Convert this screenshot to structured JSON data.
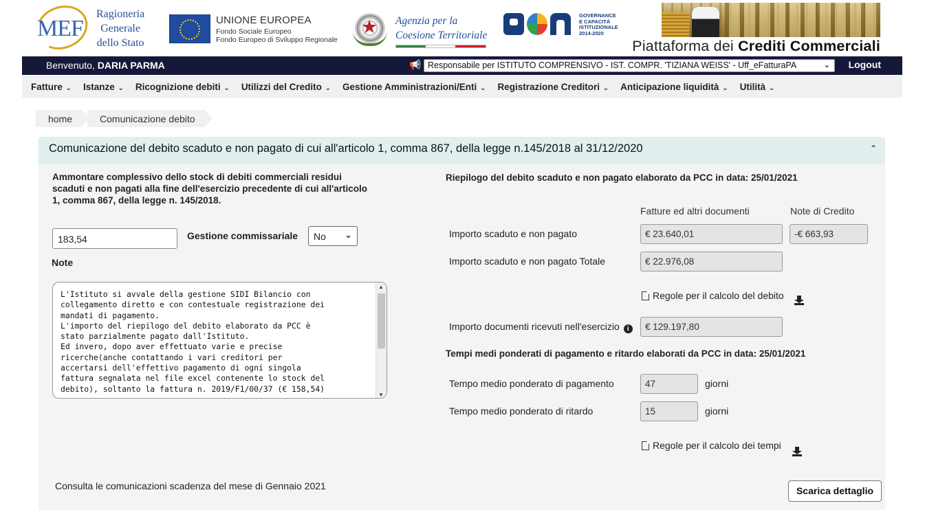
{
  "header": {
    "mef_letters": "MEF",
    "mef_lines": [
      "Ragioneria",
      "Generale",
      "dello Stato"
    ],
    "eu_title": "UNIONE EUROPEA",
    "eu_sub1": "Fondo Sociale Europeo",
    "eu_sub2": "Fondo Europeo di Sviluppo Regionale",
    "agenzia_line1": "Agenzia per la",
    "agenzia_line2": "Coesione Territoriale",
    "pon_lines": [
      "GOVERNANCE",
      "E CAPACITÀ",
      "ISTITUZIONALE",
      "2014-2020"
    ],
    "platform_prefix": "Piattaforma dei",
    "platform_name": "Crediti Commerciali"
  },
  "topbar": {
    "welcome": "Benvenuto,",
    "user": "DARIA PARMA",
    "role": "Responsabile per ISTITUTO COMPRENSIVO - IST. COMPR. 'TIZIANA WEISS' - Uff_eFatturaPA",
    "logout": "Logout"
  },
  "nav": [
    "Fatture",
    "Istanze",
    "Ricognizione debiti",
    "Utilizzi del Credito",
    "Gestione Amministrazioni/Enti",
    "Registrazione Creditori",
    "Anticipazione liquidità",
    "Utilità"
  ],
  "breadcrumb": [
    "home",
    "Comunicazione debito"
  ],
  "panel": {
    "title": "Comunicazione del debito scaduto e non pagato di cui all'articolo 1, comma 867, della legge n.145/2018 al 31/12/2020",
    "amount_label": "Ammontare complessivo dello stock di debiti commerciali residui scaduti e non pagati alla fine dell'esercizio precedente di cui all'articolo 1, comma 867, della legge n. 145/2018.",
    "amount_value": "183,54",
    "gestione_label": "Gestione commissariale",
    "gestione_value": "No",
    "note_label": "Note",
    "note_text": "L'Istituto si avvale della gestione SIDI Bilancio con\ncollegamento diretto e con contestuale registrazione dei\nmandati di pagamento.\nL'importo del riepilogo del debito elaborato da PCC è\nstato parzialmente pagato dall'Istituto.\nEd invero, dopo aver effettuato varie e precise\nricerche(anche contattando i vari creditori per\naccertarsi dell'effettivo pagamento di ogni singola\nfattura segnalata nel file excel contenente lo stock del\ndebito), soltanto la fattura n. 2019/F1/00/37 (€ 158,54)",
    "consult_text": "Consulta le comunicazioni scadenza del mese di Gennaio 2021",
    "riepilogo_title": "Riepilogo del debito scaduto e non pagato elaborato da PCC in data: 25/01/2021",
    "col_fatture": "Fatture ed altri documenti",
    "col_note": "Note di Credito",
    "importo_scaduto_label": "Importo scaduto e non pagato",
    "importo_scaduto_fatture": "€ 23.640,01",
    "importo_scaduto_note": "-€ 663,93",
    "importo_totale_label": "Importo scaduto e non pagato Totale",
    "importo_totale_value": "€ 22.976,08",
    "regole_debito": "Regole per il calcolo del debito",
    "importo_ricevuti_label": "Importo documenti ricevuti nell'esercizio",
    "importo_ricevuti_value": "€ 129.197,80",
    "tempi_title": "Tempi medi ponderati di pagamento e ritardo elaborati da PCC in data: 25/01/2021",
    "tempo_pagamento_label": "Tempo medio ponderato di pagamento",
    "tempo_pagamento_value": "47",
    "tempo_ritardo_label": "Tempo medio ponderato di ritardo",
    "tempo_ritardo_value": "15",
    "giorni": "giorni",
    "regole_tempi": "Regole per il calcolo dei tempi",
    "scarica": "Scarica dettaglio"
  },
  "colors": {
    "topbar_bg": "#16183a",
    "panel_head_bg": "#e1efef",
    "panel_bg": "#f4f4f4",
    "nav_bg": "#f0f0f0"
  }
}
